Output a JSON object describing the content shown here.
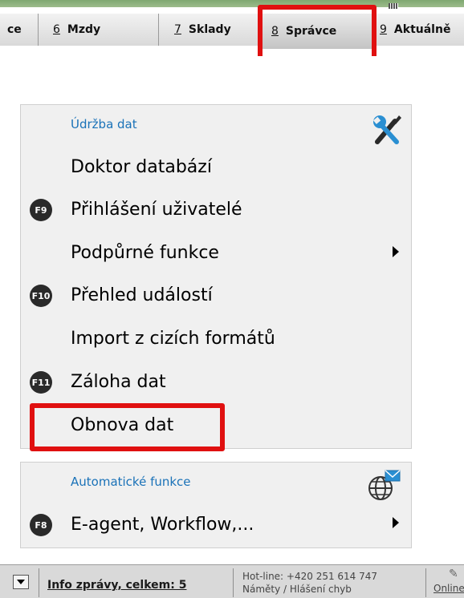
{
  "tabs": [
    {
      "label": "ce",
      "num": ""
    },
    {
      "label": "Mzdy",
      "num": "6"
    },
    {
      "label": "Sklady",
      "num": "7"
    },
    {
      "label": "Správce",
      "num": "8"
    },
    {
      "label": "Aktuálně",
      "num": "9"
    }
  ],
  "maintenance": {
    "title": "Údržba dat",
    "items": [
      {
        "label": "Doktor databází",
        "key": ""
      },
      {
        "label": "Přihlášení uživatelé",
        "key": "F9"
      },
      {
        "label": "Podpůrné funkce",
        "key": ""
      },
      {
        "label": "Přehled událostí",
        "key": "F10"
      },
      {
        "label": "Import z cizích formátů",
        "key": ""
      },
      {
        "label": "Záloha dat",
        "key": "F11"
      },
      {
        "label": "Obnova dat",
        "key": ""
      }
    ]
  },
  "automatic": {
    "title": "Automatické funkce",
    "items": [
      {
        "label": "E-agent, Workflow,...",
        "key": "F8"
      }
    ]
  },
  "status": {
    "info": "Info zprávy, celkem: 5",
    "hotline": "Hot-line: +420 251 614 747",
    "feedback": "Náměty / Hlášení chyb",
    "online": "Online"
  },
  "icons": {
    "tools": "wrench-screwdriver-icon",
    "globe": "globe-mail-icon",
    "submenu": "triangle-right-icon"
  },
  "colors": {
    "highlight": "#e01010",
    "section_title": "#1a72b8"
  }
}
